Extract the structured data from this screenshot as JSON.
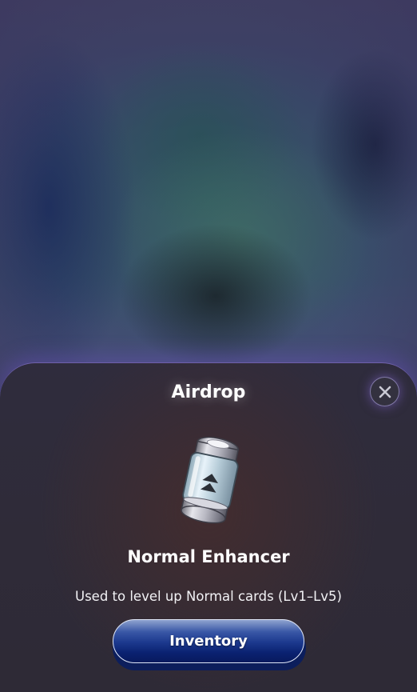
{
  "modal": {
    "title": "Airdrop",
    "close_icon": "close-icon",
    "item": {
      "icon": "enhancer-capsule-icon",
      "name": "Normal Enhancer",
      "description": "Used to level up Normal cards (Lv1–Lv5)"
    },
    "inventory_button_label": "Inventory"
  },
  "colors": {
    "sheet_background": "#2f2c3d",
    "button_primary": "#0a2170",
    "glow_accent": "#8c6ee6"
  }
}
